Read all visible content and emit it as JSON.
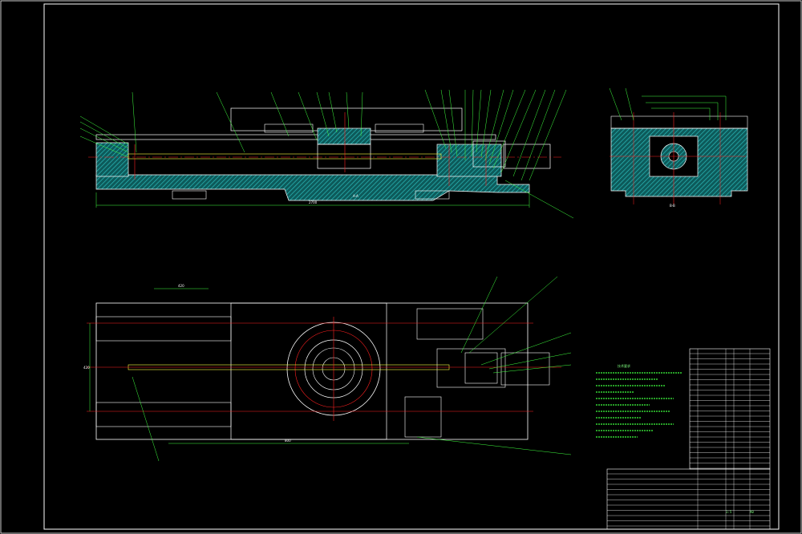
{
  "colors": {
    "background": "#000000",
    "frame": "#ffffff",
    "outline": "#ffffff",
    "hatch": "#1e9e9e",
    "leader": "#3fff3f",
    "centerline": "#ff2020",
    "yellow": "#ffff40",
    "text": "#7fff7f"
  },
  "drawing": {
    "front_view_label": "A-A",
    "side_view_label": "B-B",
    "front_length_dim": "2700",
    "plan_top_dim": "420",
    "plan_left_dim": "420",
    "plan_bottom_dim": "800",
    "notes_title": "技术要求",
    "title_block": {
      "scale": "1:5",
      "sheet": "A0"
    }
  }
}
